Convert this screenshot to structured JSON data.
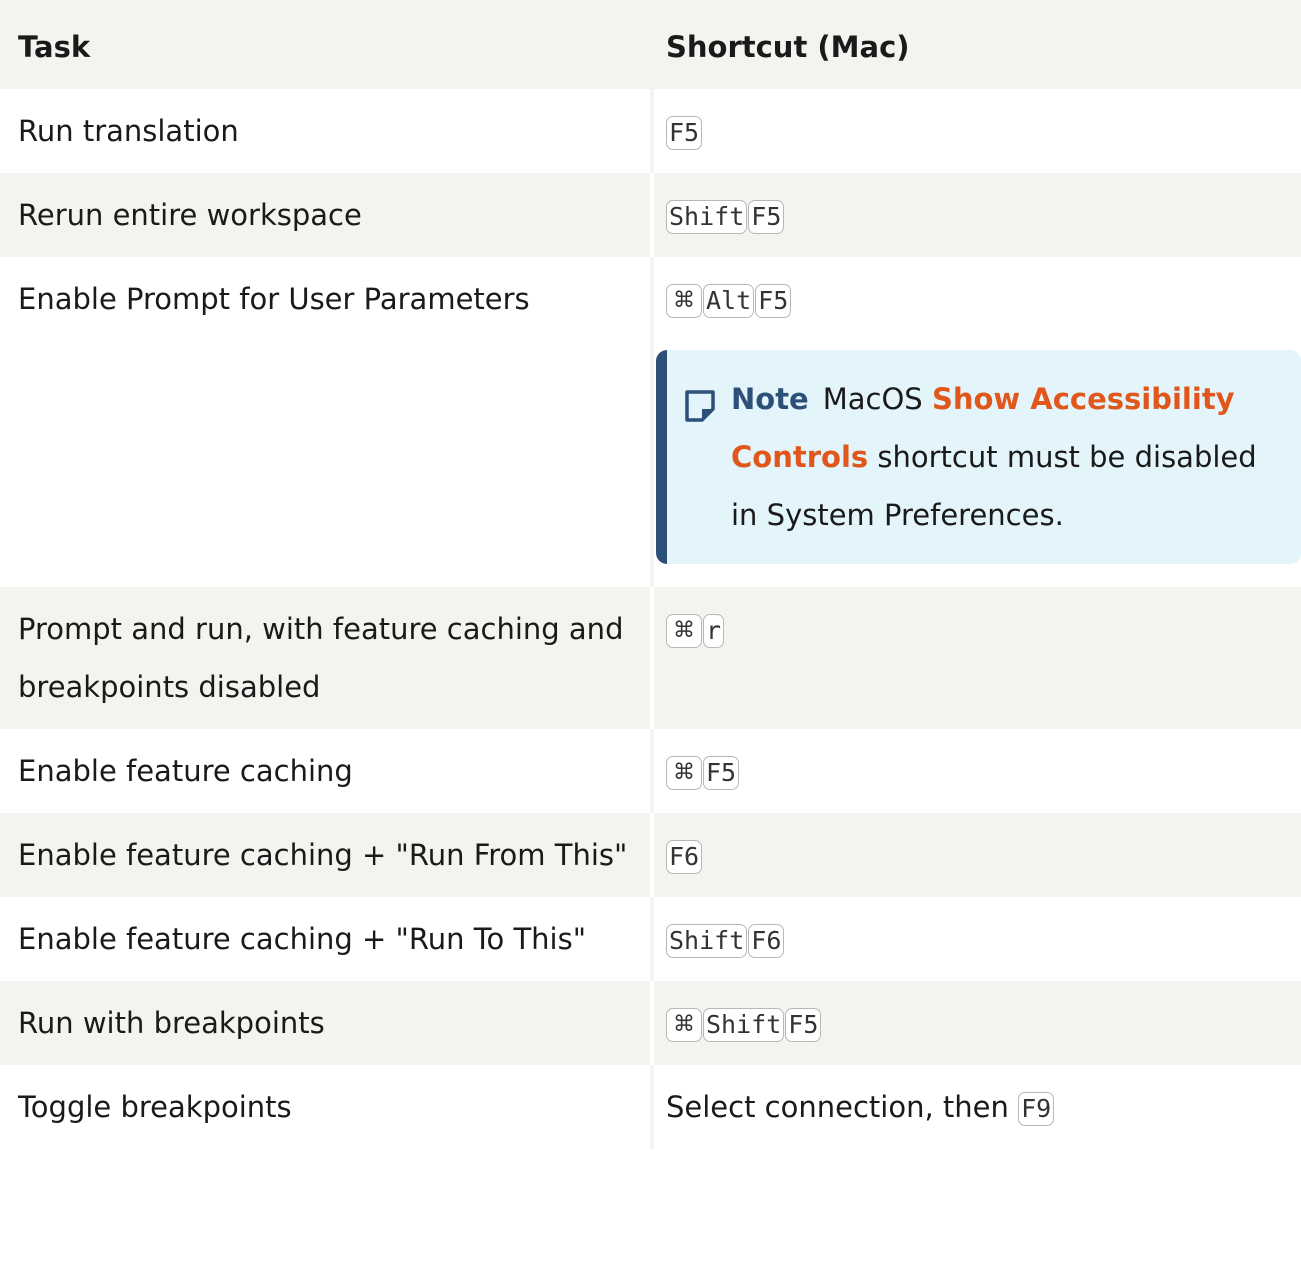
{
  "table": {
    "headers": {
      "task": "Task",
      "shortcut": "Shortcut (Mac)"
    },
    "rows": [
      {
        "task": "Run translation",
        "keys": [
          "F5"
        ]
      },
      {
        "task": "Rerun entire workspace",
        "keys": [
          "Shift",
          "F5"
        ]
      },
      {
        "task": "Enable Prompt for User Parameters",
        "keys": [
          "⌘",
          "Alt",
          "F5"
        ]
      },
      {
        "task": "Prompt and run, with feature caching and breakpoints disabled",
        "keys": [
          "⌘",
          "r"
        ]
      },
      {
        "task": "Enable feature caching",
        "keys": [
          "⌘",
          "F5"
        ]
      },
      {
        "task": "Enable feature caching + \"Run From This\"",
        "keys": [
          "F6"
        ]
      },
      {
        "task": "Enable feature caching + \"Run To This\"",
        "keys": [
          "Shift",
          "F6"
        ]
      },
      {
        "task": "Run with breakpoints",
        "keys": [
          "⌘",
          "Shift",
          "F5"
        ]
      },
      {
        "task": "Toggle breakpoints",
        "prefix": "Select connection, then",
        "keys": [
          "F9"
        ]
      }
    ]
  },
  "note": {
    "label": "Note",
    "text_before": "MacOS",
    "link": "Show Accessibility Controls",
    "text_after": "shortcut must be disabled in System Preferences."
  },
  "colors": {
    "shade": "#f4f3ef",
    "note_bg": "#e3f4fb",
    "note_accent": "#2d5078",
    "link": "#e0561b"
  }
}
